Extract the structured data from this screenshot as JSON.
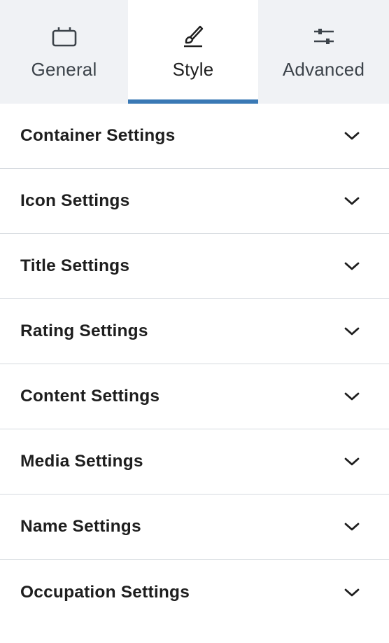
{
  "tabs": [
    {
      "label": "General",
      "icon": "calendar-icon",
      "active": false
    },
    {
      "label": "Style",
      "icon": "paintbrush-icon",
      "active": true
    },
    {
      "label": "Advanced",
      "icon": "sliders-icon",
      "active": false
    }
  ],
  "panels": [
    {
      "label": "Container Settings",
      "icon": "chevron-down-icon"
    },
    {
      "label": "Icon Settings",
      "icon": "chevron-down-icon"
    },
    {
      "label": "Title Settings",
      "icon": "chevron-down-icon"
    },
    {
      "label": "Rating Settings",
      "icon": "chevron-down-icon"
    },
    {
      "label": "Content Settings",
      "icon": "chevron-down-icon"
    },
    {
      "label": "Media Settings",
      "icon": "chevron-down-icon"
    },
    {
      "label": "Name Settings",
      "icon": "chevron-down-icon"
    },
    {
      "label": "Occupation Settings",
      "icon": "chevron-down-icon"
    }
  ],
  "colors": {
    "tab_bar_bg": "#f0f2f5",
    "active_indicator": "#3a79b5",
    "divider": "#d5dadf",
    "text": "#1e1e1e"
  }
}
